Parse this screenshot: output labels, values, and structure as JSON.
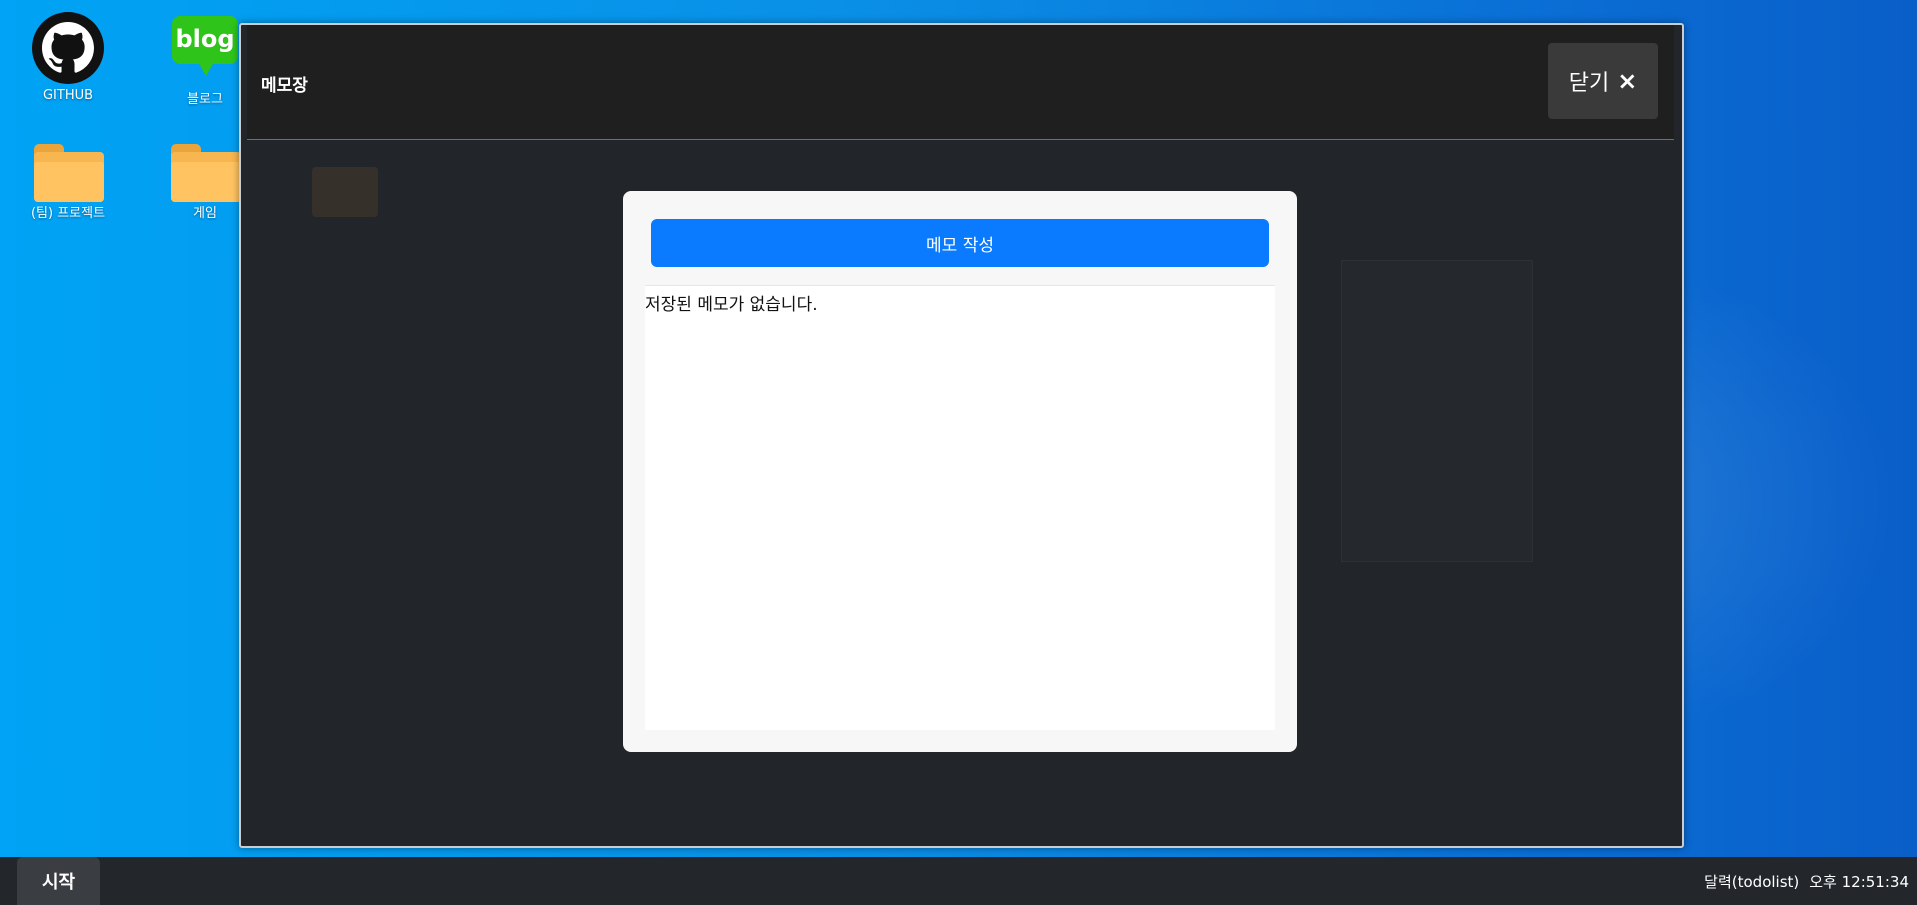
{
  "desktop": {
    "icons": [
      {
        "label": "GITHUB"
      },
      {
        "label": "블로그",
        "badge": "blog"
      },
      {
        "label": "(팀) 프로젝트"
      },
      {
        "label": "게임"
      }
    ]
  },
  "window": {
    "title": "메모장",
    "close_label": "닫기",
    "close_icon": "×"
  },
  "memo": {
    "create_button": "메모 작성",
    "empty_message": "저장된 메모가 없습니다."
  },
  "taskbar": {
    "start_label": "시작",
    "calendar_label": "달력(todolist)",
    "clock": "오후 12:51:34"
  },
  "colors": {
    "accent": "#0a7aff",
    "window_bg": "#22262b",
    "header_bg": "#1f1f1f",
    "taskbar_bg": "#23272c"
  }
}
